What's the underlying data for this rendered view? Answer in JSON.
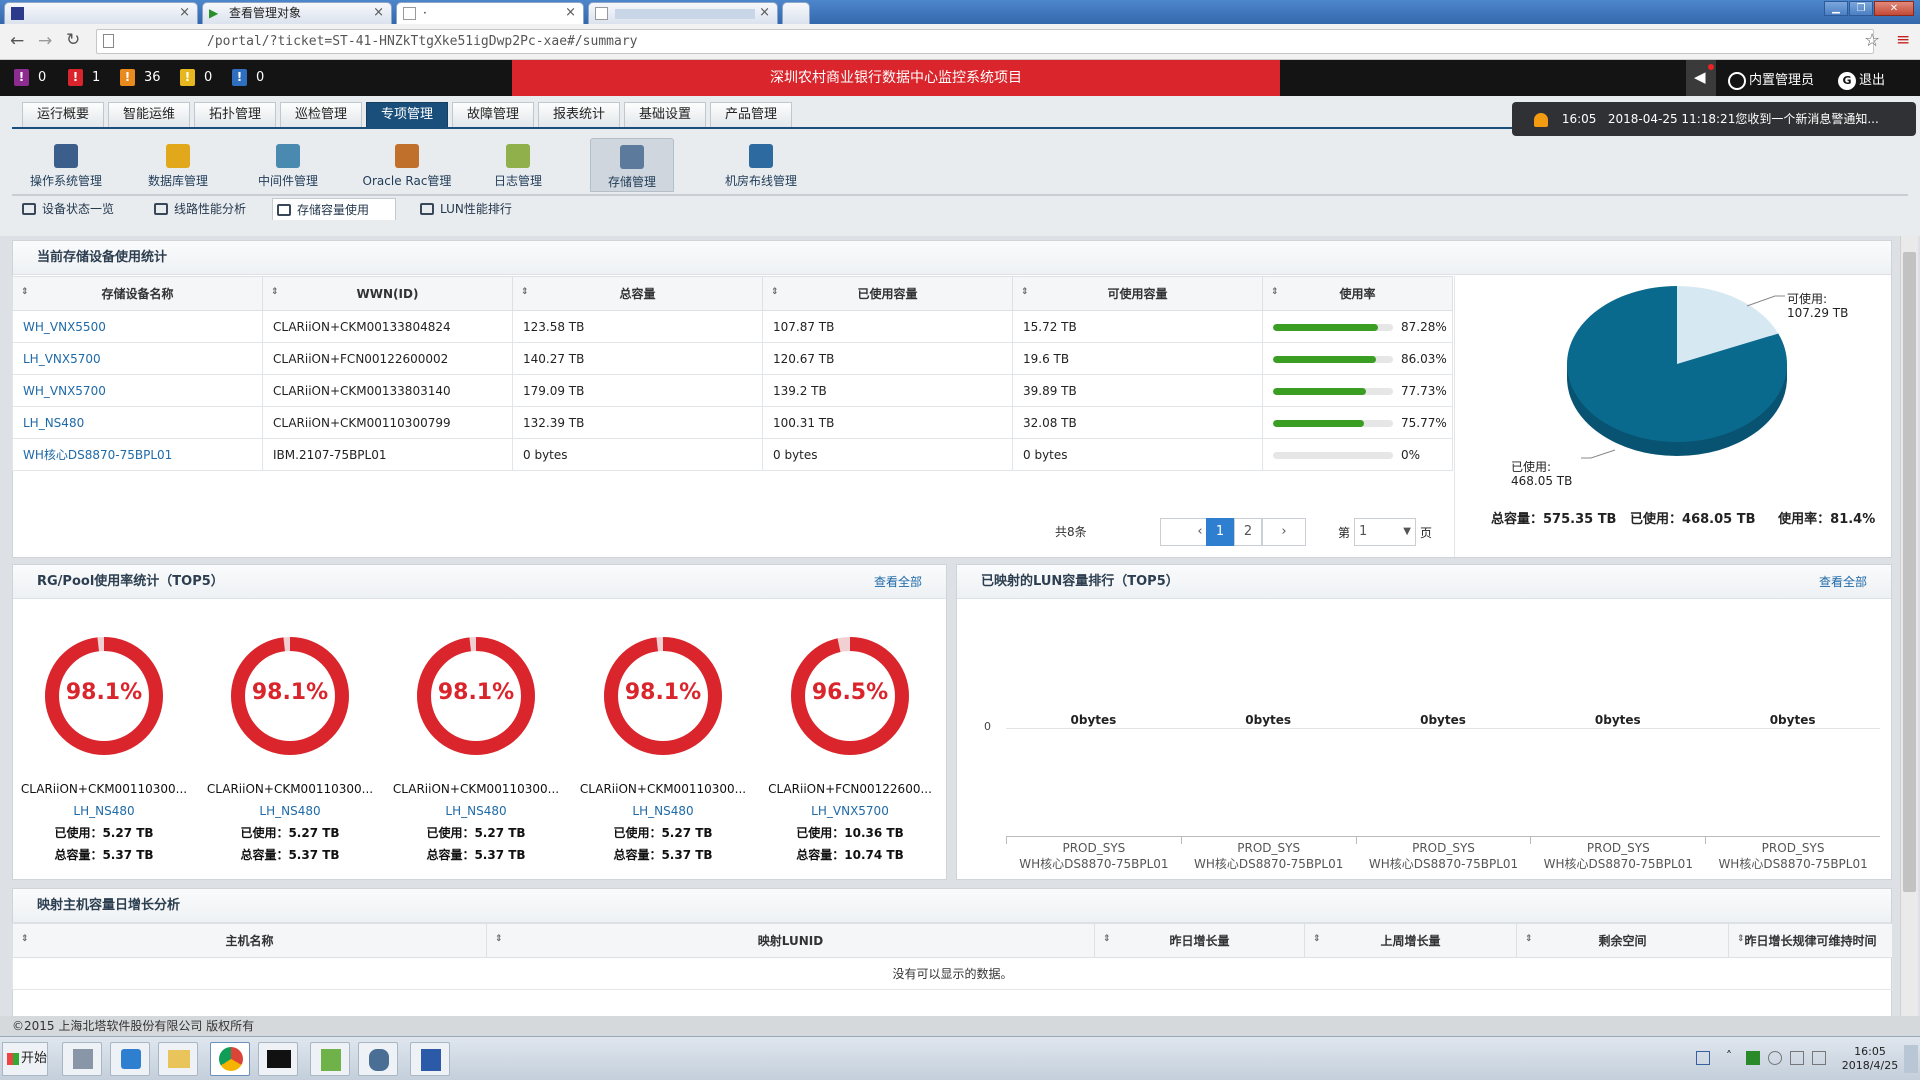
{
  "browser": {
    "tabs": [
      {
        "label": "",
        "active": false
      },
      {
        "label": "查看管理对象",
        "active": false
      },
      {
        "label": "·",
        "active": true
      },
      {
        "label": "",
        "active": false
      }
    ],
    "url": "/portal/?ticket=ST-41-HNZkTtgXke51igDwp2Pc-xae#/summary"
  },
  "alerts": [
    {
      "color": "#8d2b8f",
      "glyph": "!",
      "count": "0"
    },
    {
      "color": "#d9252b",
      "glyph": "!",
      "count": "1"
    },
    {
      "color": "#e98a1f",
      "glyph": "!",
      "count": "36"
    },
    {
      "color": "#e7b81d",
      "glyph": "!",
      "count": "0"
    },
    {
      "color": "#2f6fc0",
      "glyph": "!",
      "count": "0"
    }
  ],
  "header": {
    "title": "深圳农村商业银行数据中心监控系统项目",
    "user": "内置管理员",
    "logout": "退出"
  },
  "notification": {
    "time": "16:05",
    "text": "2018-04-25 11:18:21您收到一个新消息警通知..."
  },
  "nav": {
    "main": [
      "运行概要",
      "智能运维",
      "拓扑管理",
      "巡检管理",
      "专项管理",
      "故障管理",
      "报表统计",
      "基础设置",
      "产品管理"
    ],
    "active_main": "专项管理",
    "sub": [
      "操作系统管理",
      "数据库管理",
      "中间件管理",
      "Oracle Rac管理",
      "日志管理",
      "存储管理",
      "机房布线管理"
    ],
    "active_sub": "存储管理",
    "level3": [
      "设备状态一览",
      "线路性能分析",
      "存储容量使用",
      "LUN性能排行"
    ],
    "active_level3": "存储容量使用"
  },
  "storage": {
    "title": "当前存储设备使用统计",
    "columns": [
      "存储设备名称",
      "WWN(ID)",
      "总容量",
      "已使用容量",
      "可使用容量",
      "使用率"
    ],
    "rows": [
      {
        "name": "WH_VNX5500",
        "wwn": "CLARiiON+CKM00133804824",
        "total": "123.58 TB",
        "used": "107.87 TB",
        "free": "15.72 TB",
        "rate": "87.28%",
        "pct": 87.28
      },
      {
        "name": "LH_VNX5700",
        "wwn": "CLARiiON+FCN00122600002",
        "total": "140.27 TB",
        "used": "120.67 TB",
        "free": "19.6 TB",
        "rate": "86.03%",
        "pct": 86.03
      },
      {
        "name": "WH_VNX5700",
        "wwn": "CLARiiON+CKM00133803140",
        "total": "179.09 TB",
        "used": "139.2 TB",
        "free": "39.89 TB",
        "rate": "77.73%",
        "pct": 77.73
      },
      {
        "name": "LH_NS480",
        "wwn": "CLARiiON+CKM00110300799",
        "total": "132.39 TB",
        "used": "100.31 TB",
        "free": "32.08 TB",
        "rate": "75.77%",
        "pct": 75.77
      },
      {
        "name": "WH核心DS8870-75BPL01",
        "wwn": "IBM.2107-75BPL01",
        "total": "0 bytes",
        "used": "0 bytes",
        "free": "0 bytes",
        "rate": "0%",
        "pct": 0
      }
    ],
    "pager": {
      "total": "共8条",
      "pages": [
        "1",
        "2"
      ],
      "current": "1",
      "prev": "‹",
      "next": "›",
      "goto_prefix": "第",
      "goto_value": "1",
      "goto_suffix": "页"
    },
    "pie": {
      "free_label": "可使用:",
      "free_value": "107.29 TB",
      "used_label": "已使用:",
      "used_value": "468.05 TB",
      "used_pct": 81.4,
      "summary": "总容量：575.35 TB   已使用：468.05 TB     使用率：81.4%",
      "color_used": "#0a6a8e",
      "color_free": "#d6e8f2"
    }
  },
  "rg_pool": {
    "title": "RG/Pool使用率统计（TOP5）",
    "more": "查看全部",
    "items": [
      {
        "pct_label": "98.1%",
        "pct": 98.1,
        "name": "CLARiiON+CKM00110300...",
        "device": "LH_NS480",
        "used": "已使用：5.27 TB",
        "total": "总容量：5.37 TB"
      },
      {
        "pct_label": "98.1%",
        "pct": 98.1,
        "name": "CLARiiON+CKM00110300...",
        "device": "LH_NS480",
        "used": "已使用：5.27 TB",
        "total": "总容量：5.37 TB"
      },
      {
        "pct_label": "98.1%",
        "pct": 98.1,
        "name": "CLARiiON+CKM00110300...",
        "device": "LH_NS480",
        "used": "已使用：5.27 TB",
        "total": "总容量：5.37 TB"
      },
      {
        "pct_label": "98.1%",
        "pct": 98.1,
        "name": "CLARiiON+CKM00110300...",
        "device": "LH_NS480",
        "used": "已使用：5.27 TB",
        "total": "总容量：5.37 TB"
      },
      {
        "pct_label": "96.5%",
        "pct": 96.5,
        "name": "CLARiiON+FCN00122600...",
        "device": "LH_VNX5700",
        "used": "已使用：10.36 TB",
        "total": "总容量：10.74 TB"
      }
    ],
    "color": "#d9252b"
  },
  "lun": {
    "title": "已映射的LUN容量排行（TOP5）",
    "more": "查看全部",
    "chart_data": {
      "type": "bar",
      "categories": [
        "PROD_SYS WH核心DS8870-75BPL01",
        "PROD_SYS WH核心DS8870-75BPL01",
        "PROD_SYS WH核心DS8870-75BPL01",
        "PROD_SYS WH核心DS8870-75BPL01",
        "PROD_SYS WH核心DS8870-75BPL01"
      ],
      "cat_line1": [
        "PROD_SYS",
        "PROD_SYS",
        "PROD_SYS",
        "PROD_SYS",
        "PROD_SYS"
      ],
      "cat_line2": [
        "WH核心DS8870-75BPL01",
        "WH核心DS8870-75BPL01",
        "WH核心DS8870-75BPL01",
        "WH核心DS8870-75BPL01",
        "WH核心DS8870-75BPL01"
      ],
      "values": [
        0,
        0,
        0,
        0,
        0
      ],
      "data_labels": [
        "0bytes",
        "0bytes",
        "0bytes",
        "0bytes",
        "0bytes"
      ],
      "y_tick": "0"
    }
  },
  "growth": {
    "title": "映射主机容量日增长分析",
    "columns": [
      "主机名称",
      "映射LUNID",
      "昨日增长量",
      "上周增长量",
      "剩余空间",
      "昨日增长规律可维持时间"
    ],
    "empty": "没有可以显示的数据。"
  },
  "footer": "©2015 上海北塔软件股份有限公司 版权所有",
  "taskbar": {
    "start": "开始",
    "time": "16:05",
    "date": "2018/4/25"
  }
}
